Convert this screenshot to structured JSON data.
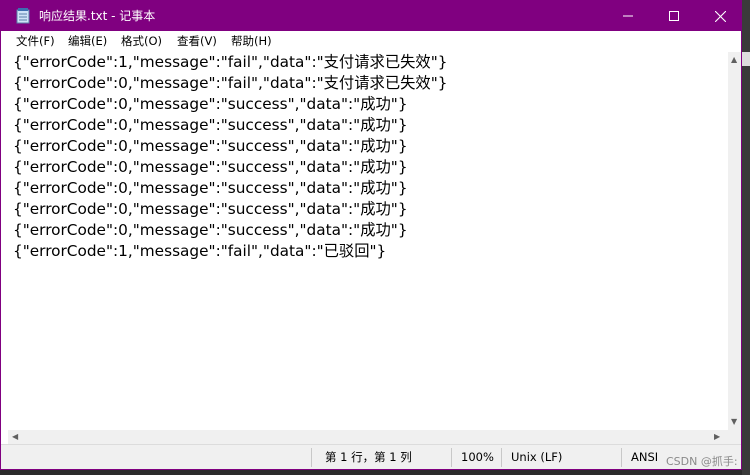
{
  "window": {
    "title": "响应结果.txt - 记事本"
  },
  "menu": [
    {
      "label": "文件(F)"
    },
    {
      "label": "编辑(E)"
    },
    {
      "label": "格式(O)"
    },
    {
      "label": "查看(V)"
    },
    {
      "label": "帮助(H)"
    }
  ],
  "editor": {
    "lines": [
      "{\"errorCode\":1,\"message\":\"fail\",\"data\":\"支付请求已失效\"}",
      "{\"errorCode\":0,\"message\":\"fail\",\"data\":\"支付请求已失效\"}",
      "{\"errorCode\":0,\"message\":\"success\",\"data\":\"成功\"}",
      "{\"errorCode\":0,\"message\":\"success\",\"data\":\"成功\"}",
      "{\"errorCode\":0,\"message\":\"success\",\"data\":\"成功\"}",
      "{\"errorCode\":0,\"message\":\"success\",\"data\":\"成功\"}",
      "{\"errorCode\":0,\"message\":\"success\",\"data\":\"成功\"}",
      "{\"errorCode\":0,\"message\":\"success\",\"data\":\"成功\"}",
      "{\"errorCode\":0,\"message\":\"success\",\"data\":\"成功\"}",
      "{\"errorCode\":1,\"message\":\"fail\",\"data\":\"已驳回\"}"
    ]
  },
  "status": {
    "position": "第 1 行，第 1 列",
    "zoom": "100%",
    "line_ending": "Unix (LF)",
    "encoding": "ANSI"
  },
  "watermark": "CSDN @抓手:",
  "colors": {
    "titlebar": "#800080"
  },
  "icons": [
    "notepad-icon",
    "minimize-icon",
    "maximize-icon",
    "close-icon",
    "scroll-up-arrow",
    "scroll-down-arrow",
    "scroll-left-arrow",
    "scroll-right-arrow",
    "resize-gripper-icon"
  ]
}
